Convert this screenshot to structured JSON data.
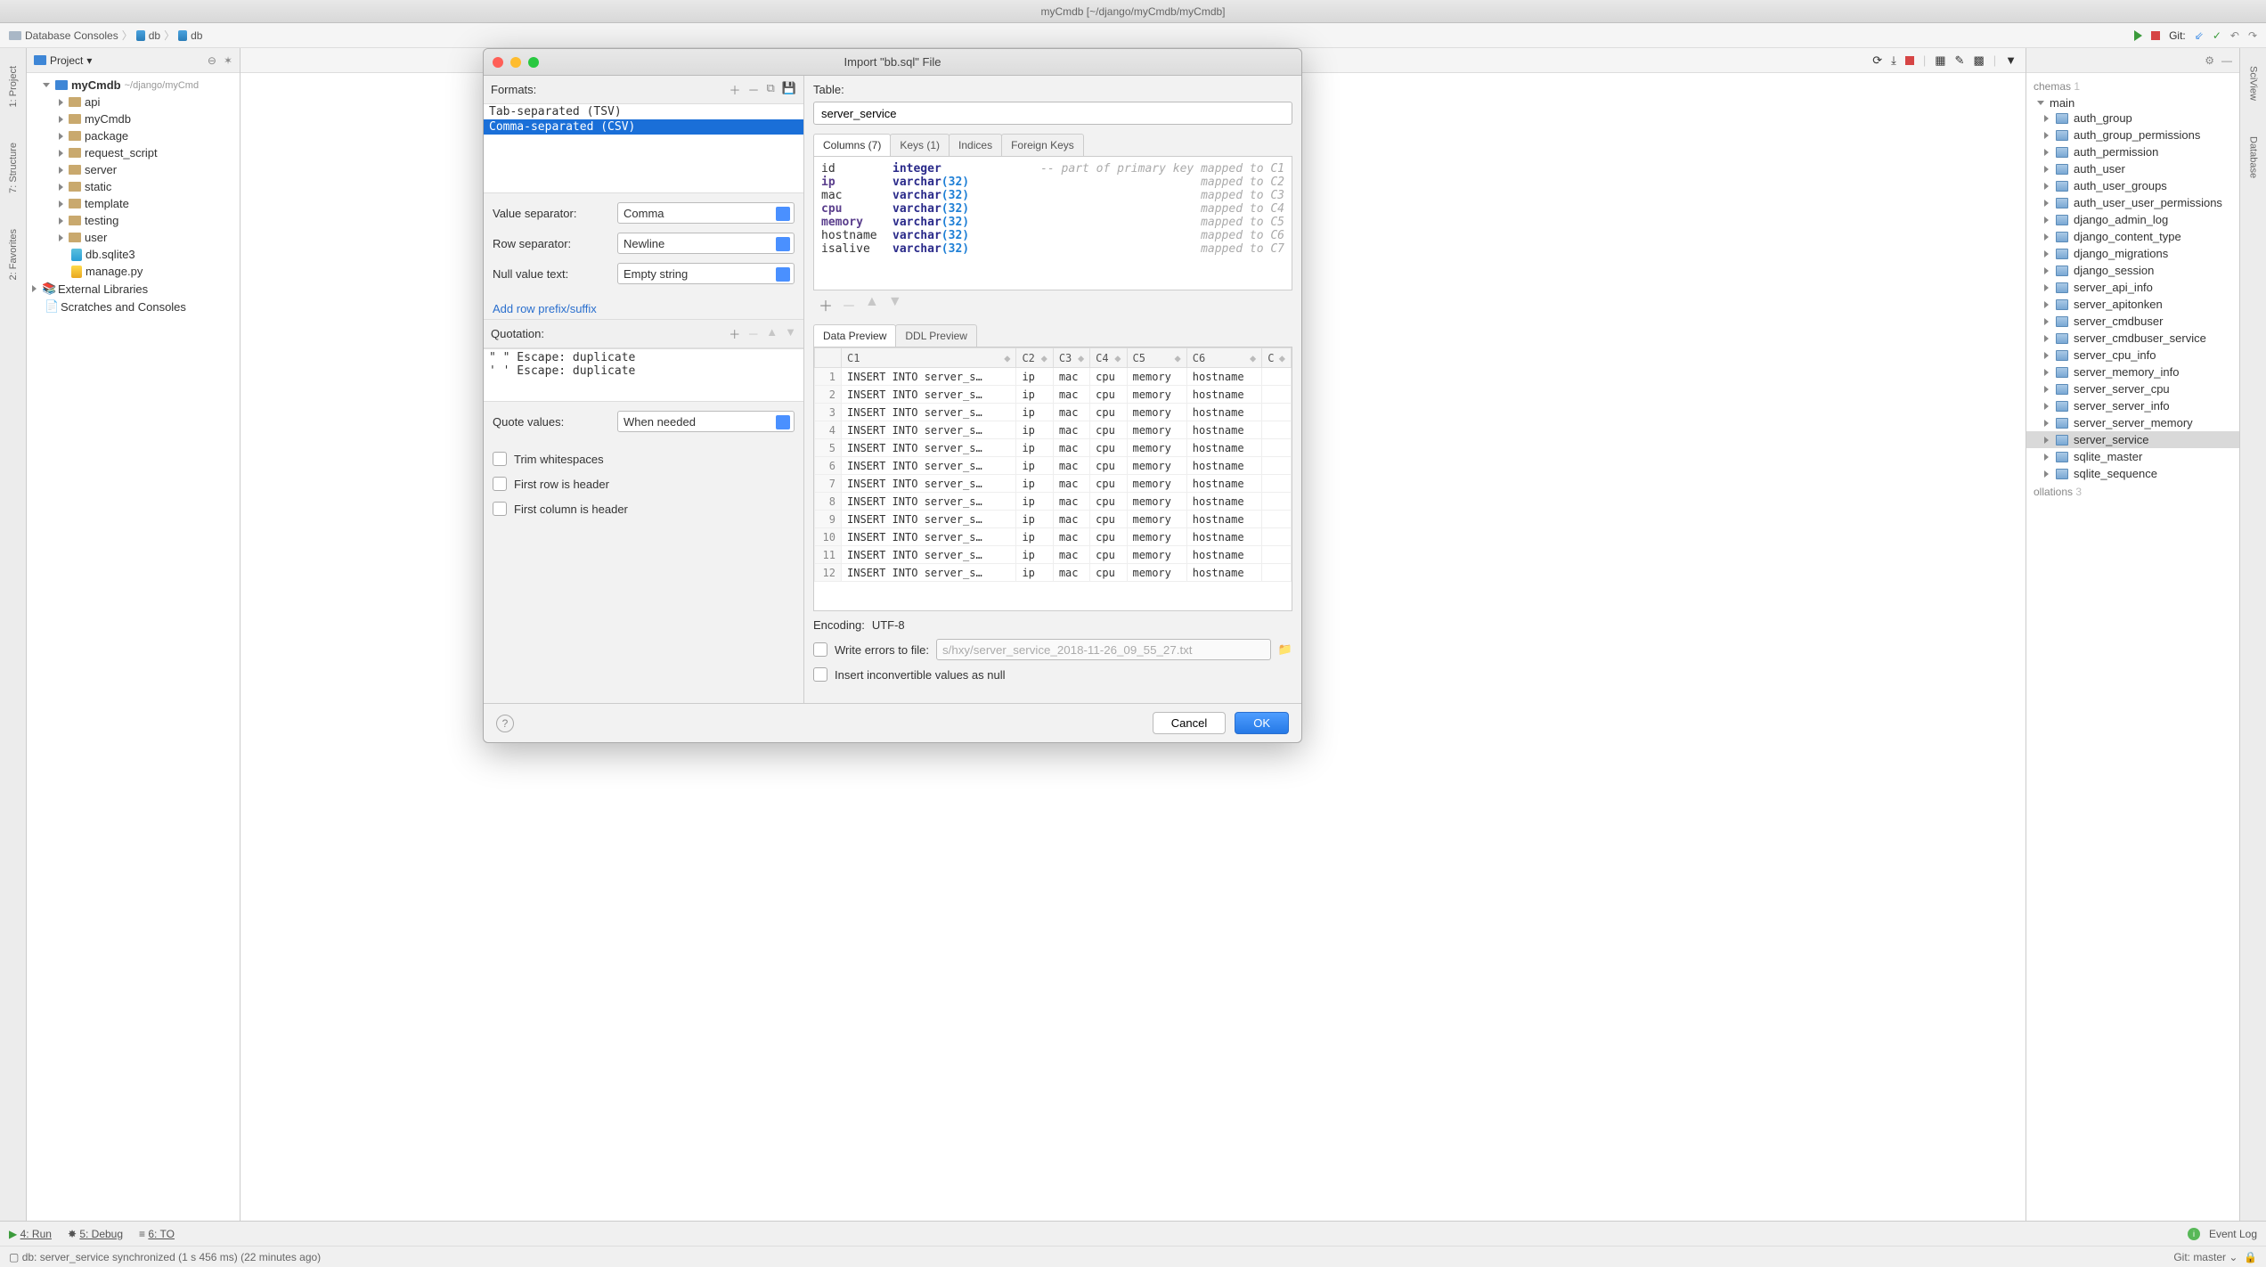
{
  "title": "myCmdb [~/django/myCmdb/myCmdb]",
  "breadcrumb": [
    "Database Consoles",
    "db",
    "db"
  ],
  "git_label": "Git:",
  "project_header": "Project",
  "project_root": {
    "name": "myCmdb",
    "path": "~/django/myCmd"
  },
  "project_tree": [
    {
      "name": "api",
      "type": "dir"
    },
    {
      "name": "myCmdb",
      "type": "dir"
    },
    {
      "name": "package",
      "type": "dir"
    },
    {
      "name": "request_script",
      "type": "dir"
    },
    {
      "name": "server",
      "type": "dir"
    },
    {
      "name": "static",
      "type": "dir"
    },
    {
      "name": "template",
      "type": "dir"
    },
    {
      "name": "testing",
      "type": "dir"
    },
    {
      "name": "user",
      "type": "dir"
    },
    {
      "name": "db.sqlite3",
      "type": "sqlite"
    },
    {
      "name": "manage.py",
      "type": "py"
    }
  ],
  "project_extras": [
    "External Libraries",
    "Scratches and Consoles"
  ],
  "dialog": {
    "title": "Import \"bb.sql\" File",
    "formats_label": "Formats:",
    "formats": [
      {
        "label": "Tab-separated (TSV)",
        "selected": false
      },
      {
        "label": "Comma-separated (CSV)",
        "selected": true
      }
    ],
    "value_separator_label": "Value separator:",
    "value_separator": "Comma",
    "row_separator_label": "Row separator:",
    "row_separator": "Newline",
    "null_value_label": "Null value text:",
    "null_value": "Empty string",
    "add_prefix_link": "Add row prefix/suffix",
    "quotation_label": "Quotation:",
    "quotations": [
      {
        "open": "\"",
        "close": "\"",
        "escape": "Escape: duplicate"
      },
      {
        "open": "'",
        "close": "'",
        "escape": "Escape: duplicate"
      }
    ],
    "quote_values_label": "Quote values:",
    "quote_values": "When needed",
    "checks": {
      "trim": "Trim whitespaces",
      "first_row": "First row is header",
      "first_col": "First column is header"
    },
    "table_label": "Table:",
    "table_name": "server_service",
    "col_tabs": [
      "Columns (7)",
      "Keys (1)",
      "Indices",
      "Foreign Keys"
    ],
    "columns": [
      {
        "name": "id",
        "type": "integer",
        "hint": "-- part of primary key mapped to C1"
      },
      {
        "name": "ip",
        "type": "varchar(32)",
        "hint": "mapped to C2"
      },
      {
        "name": "mac",
        "type": "varchar(32)",
        "hint": "mapped to C3"
      },
      {
        "name": "cpu",
        "type": "varchar(32)",
        "hint": "mapped to C4"
      },
      {
        "name": "memory",
        "type": "varchar(32)",
        "hint": "mapped to C5"
      },
      {
        "name": "hostname",
        "type": "varchar(32)",
        "hint": "mapped to C6"
      },
      {
        "name": "isalive",
        "type": "varchar(32)",
        "hint": "mapped to C7"
      }
    ],
    "preview_tabs": [
      "Data Preview",
      "DDL Preview"
    ],
    "preview_headers": [
      "C1",
      "C2",
      "C3",
      "C4",
      "C5",
      "C6",
      "C"
    ],
    "preview_rows": [
      [
        "INSERT INTO server_s…",
        "ip",
        "mac",
        "cpu",
        "memory",
        "hostname"
      ],
      [
        "INSERT INTO server_s…",
        "ip",
        "mac",
        "cpu",
        "memory",
        "hostname"
      ],
      [
        "INSERT INTO server_s…",
        "ip",
        "mac",
        "cpu",
        "memory",
        "hostname"
      ],
      [
        "INSERT INTO server_s…",
        "ip",
        "mac",
        "cpu",
        "memory",
        "hostname"
      ],
      [
        "INSERT INTO server_s…",
        "ip",
        "mac",
        "cpu",
        "memory",
        "hostname"
      ],
      [
        "INSERT INTO server_s…",
        "ip",
        "mac",
        "cpu",
        "memory",
        "hostname"
      ],
      [
        "INSERT INTO server_s…",
        "ip",
        "mac",
        "cpu",
        "memory",
        "hostname"
      ],
      [
        "INSERT INTO server_s…",
        "ip",
        "mac",
        "cpu",
        "memory",
        "hostname"
      ],
      [
        "INSERT INTO server_s…",
        "ip",
        "mac",
        "cpu",
        "memory",
        "hostname"
      ],
      [
        "INSERT INTO server_s…",
        "ip",
        "mac",
        "cpu",
        "memory",
        "hostname"
      ],
      [
        "INSERT INTO server_s…",
        "ip",
        "mac",
        "cpu",
        "memory",
        "hostname"
      ],
      [
        "INSERT INTO server_s…",
        "ip",
        "mac",
        "cpu",
        "memory",
        "hostname"
      ]
    ],
    "encoding_label": "Encoding:",
    "encoding": "UTF-8",
    "write_errors_label": "Write errors to file:",
    "write_errors_path": "s/hxy/server_service_2018-11-26_09_55_27.txt",
    "insert_null_label": "Insert inconvertible values as null",
    "cancel": "Cancel",
    "ok": "OK"
  },
  "db_panel": {
    "schemas_label": "chemas",
    "schemas_count": "1",
    "schema": "main",
    "tables": [
      "auth_group",
      "auth_group_permissions",
      "auth_permission",
      "auth_user",
      "auth_user_groups",
      "auth_user_user_permissions",
      "django_admin_log",
      "django_content_type",
      "django_migrations",
      "django_session",
      "server_api_info",
      "server_apitonken",
      "server_cmdbuser",
      "server_cmdbuser_service",
      "server_cpu_info",
      "server_memory_info",
      "server_server_cpu",
      "server_server_info",
      "server_server_memory",
      "server_service",
      "sqlite_master",
      "sqlite_sequence"
    ],
    "selected": "server_service",
    "collations_label": "ollations",
    "collations_count": "3"
  },
  "left_tabs": [
    "1: Project",
    "7: Structure",
    "2: Favorites"
  ],
  "right_tabs": [
    "SciView",
    "Database"
  ],
  "bottom_tabs": {
    "run": "4: Run",
    "debug": "5: Debug",
    "todo": "6: TO"
  },
  "event_log": "Event Log",
  "status": "db: server_service synchronized (1 s 456 ms) (22 minutes ago)",
  "git_branch": "Git: master"
}
